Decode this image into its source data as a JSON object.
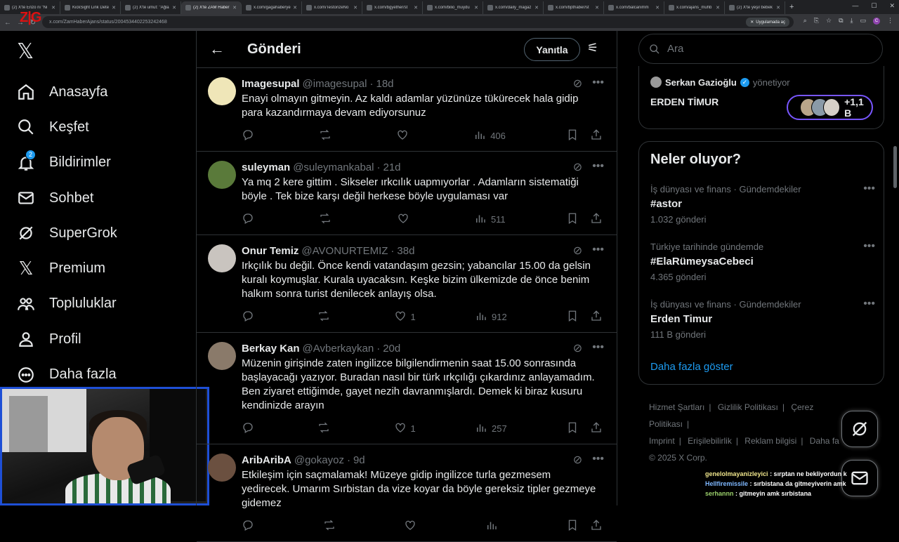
{
  "browser": {
    "tabs": [
      {
        "label": "(2) X'te Enzo ni \"Ni",
        "active": false
      },
      {
        "label": "KickSight Link Dete",
        "active": false
      },
      {
        "label": "(2) X'te umut: \"Ağla",
        "active": false
      },
      {
        "label": "(2) X'te ZAM Haber",
        "active": true
      },
      {
        "label": "x.com/gagahaberye",
        "active": false
      },
      {
        "label": "x.com/TestorizeNo",
        "active": false
      },
      {
        "label": "x.com/bgyether/st",
        "active": false
      },
      {
        "label": "x.com/bilio_muydu",
        "active": false
      },
      {
        "label": "x.com/daily_magaz",
        "active": false
      },
      {
        "label": "x.com/bpthaber/st",
        "active": false
      },
      {
        "label": "x.com/balcanimm",
        "active": false
      },
      {
        "label": "x.com/ajans_muhb",
        "active": false
      },
      {
        "label": "(2) X'te yeşil bebek",
        "active": false
      }
    ],
    "url": "x.com/ZamHaberAjans/status/2004534402253242468",
    "url_pill": "Uygulamada aç",
    "overlay_logo": "Z|G"
  },
  "sidebar": {
    "items": [
      {
        "label": "Anasayfa",
        "icon": "home-icon"
      },
      {
        "label": "Keşfet",
        "icon": "search-icon"
      },
      {
        "label": "Bildirimler",
        "icon": "bell-icon",
        "badge": "2"
      },
      {
        "label": "Sohbet",
        "icon": "mail-icon"
      },
      {
        "label": "SuperGrok",
        "icon": "grok-icon"
      },
      {
        "label": "Premium",
        "icon": "x-icon"
      },
      {
        "label": "Topluluklar",
        "icon": "people-icon"
      },
      {
        "label": "Profil",
        "icon": "person-icon"
      },
      {
        "label": "Daha fazla",
        "icon": "more-circle-icon"
      }
    ]
  },
  "main": {
    "title": "Gönderi",
    "reply_button": "Yanıtla",
    "tweets": [
      {
        "name": "Imagesupal",
        "handle": "@imagesupal",
        "time": "18d",
        "text": "Enayi olmayın gitmeyin. Az kaldı adamlar yüzünüze tükürecek hala gidip para kazandırmaya devam ediyorsunuz",
        "replies": "",
        "retweets": "",
        "likes": "",
        "views": "406",
        "avatar_color": "#efe6b8"
      },
      {
        "name": "suleyman",
        "handle": "@suleymankabal",
        "time": "21d",
        "text": "Ya mq 2 kere gittim . Sikseler ırkcılık uapmıyorlar . Adamların sistematiği böyle . Tek bize karşı değil herkese böyle uygulaması var",
        "replies": "",
        "retweets": "",
        "likes": "",
        "views": "511",
        "avatar_color": "#5a7a3a"
      },
      {
        "name": "Onur Temiz",
        "handle": "@AVONURTEMIZ",
        "time": "38d",
        "text": "Irkçılık bu değil. Önce kendi vatandaşım gezsin; yabancılar 15.00 da gelsin kuralı koymuşlar. Kurala uyacaksın. Keşke bizim ülkemizde de önce benim halkım sonra turist denilecek anlayış olsa.",
        "replies": "",
        "retweets": "",
        "likes": "1",
        "views": "912",
        "avatar_color": "#c9c4bf"
      },
      {
        "name": "Berkay Kan",
        "handle": "@Avberkaykan",
        "time": "20d",
        "text": "Müzenin girişinde zaten ingilizce bilgilendirmenin saat 15.00 sonrasında başlayacağı yazıyor. Buradan nasıl bir türk ırkçılığı çıkardınız anlayamadım. Ben ziyaret ettiğimde, gayet nezih davranmışlardı. Demek ki biraz kusuru kendinizde arayın",
        "replies": "",
        "retweets": "",
        "likes": "1",
        "views": "257",
        "avatar_color": "#8a7a6a"
      },
      {
        "name": "AribAribA",
        "handle": "@gokayoz",
        "time": "9d",
        "text": "Etkileşim için saçmalamak! Müzeye gidip ingilizce turla gezmesem yedirecek. Umarım Sırbistan da vize koyar da böyle gereksiz tipler gezmeye gidemez",
        "replies": "",
        "retweets": "",
        "likes": "",
        "views": "",
        "avatar_color": "#6b5040"
      }
    ]
  },
  "right": {
    "search_placeholder": "Ara",
    "manager": {
      "name": "Serkan Gazioğlu",
      "role": "yönetiyor"
    },
    "account_name": "ERDEN TİMUR",
    "followers": "+1,1 B",
    "trends_title": "Neler oluyor?",
    "trends": [
      {
        "context": "İş dünyası ve finans · Gündemdekiler",
        "title": "#astor",
        "count": "1.032 gönderi"
      },
      {
        "context": "Türkiye tarihinde gündemde",
        "title": "#ElaRümeysaCebeci",
        "count": "4.365 gönderi"
      },
      {
        "context": "İş dünyası ve finans · Gündemdekiler",
        "title": "Erden Timur",
        "count": "111 B gönderi"
      }
    ],
    "show_more": "Daha fazla göster",
    "footer": [
      "Hizmet Şartları",
      "Gizlilik Politikası",
      "Çerez Politikası",
      "Imprint",
      "Erişilebilirlik",
      "Reklam bilgisi",
      "Daha fa"
    ],
    "copyright": "© 2025 X Corp."
  },
  "stream_chat": [
    {
      "user": "genelolmayanizleyici",
      "msg": ": sırptan ne bekliyordun k"
    },
    {
      "user": "Hellfiremissile",
      "msg": ": sırbistana da gitmeyiverin amk"
    },
    {
      "user": "serhannn",
      "msg": ": gitmeyin amk sırbistana"
    }
  ],
  "colors": {
    "accent": "#1d9bf0",
    "border": "#2f3336",
    "muted": "#71767b",
    "webcam_frame": "#1e4fd6"
  }
}
